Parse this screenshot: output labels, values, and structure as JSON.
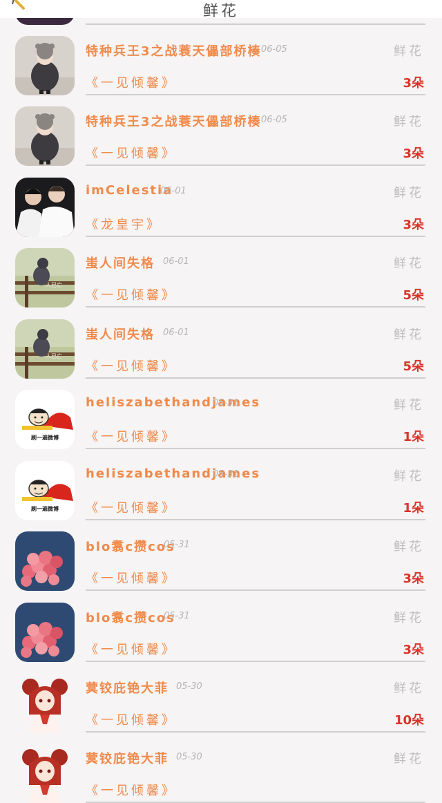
{
  "header": {
    "title": "鲜花"
  },
  "rows": [
    {
      "name": "特种兵王3之战蓑天儡部桥楱",
      "date": "06-05",
      "gift_label": "鲜花",
      "song": "《一见倾馨》",
      "count": "3朵",
      "avatar": "child-winter-coat"
    },
    {
      "name": "特种兵王3之战蓑天儡部桥楱",
      "date": "06-05",
      "gift_label": "鲜花",
      "song": "《一见倾馨》",
      "count": "3朵",
      "avatar": "child-winter-coat"
    },
    {
      "name": "imCelestia",
      "date": "06-01",
      "gift_label": "鲜花",
      "song": "《龙皇宇》",
      "count": "3朵",
      "avatar": "two-men-white-shirts"
    },
    {
      "name": "蚩人间失格",
      "date": "06-01",
      "gift_label": "鲜花",
      "song": "《一见倾馨》",
      "count": "5朵",
      "avatar": "person-on-fence"
    },
    {
      "name": "蚩人间失格",
      "date": "06-01",
      "gift_label": "鲜花",
      "song": "《一见倾馨》",
      "count": "5朵",
      "avatar": "person-on-fence"
    },
    {
      "name": "heliszabethandjames",
      "date": "05-31",
      "gift_label": "鲜花",
      "song": "《一见倾馨》",
      "count": "1朵",
      "avatar": "meme-cartoon"
    },
    {
      "name": "heliszabethandjames",
      "date": "05-31",
      "gift_label": "鲜花",
      "song": "《一见倾馨》",
      "count": "1朵",
      "avatar": "meme-cartoon"
    },
    {
      "name": "blo翥c攒cos",
      "date": "05-31",
      "gift_label": "鲜花",
      "song": "《一见倾馨》",
      "count": "3朵",
      "avatar": "pink-balloons"
    },
    {
      "name": "blo翥c攒cos",
      "date": "05-31",
      "gift_label": "鲜花",
      "song": "《一见倾馨》",
      "count": "3朵",
      "avatar": "pink-balloons"
    },
    {
      "name": "蓂铰庇铯大菲",
      "date": "05-30",
      "gift_label": "鲜花",
      "song": "《一见倾馨》",
      "count": "10朵",
      "avatar": "anime-girl-red"
    },
    {
      "name": "蓂铰庇铯大菲",
      "date": "05-30",
      "gift_label": "鲜花",
      "song": "《一见倾馨》",
      "count": "",
      "avatar": "anime-girl-red"
    }
  ],
  "meme_caption": "刷一遍微博",
  "colors": {
    "accent": "#f08a4b",
    "count": "#d9342b",
    "muted": "#bdbdbd"
  }
}
